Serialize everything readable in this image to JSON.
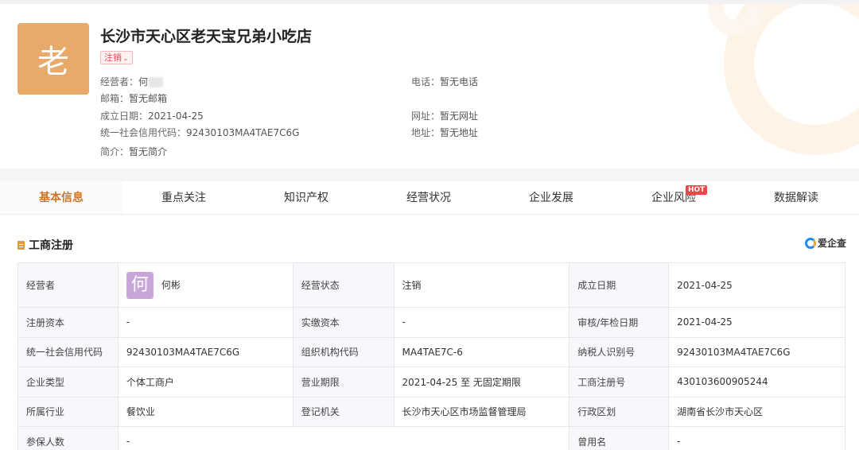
{
  "company": {
    "logo_char": "老",
    "name": "长沙市天心区老天宝兄弟小吃店",
    "status_tag": "注销",
    "operator_label": "经营者：",
    "operator_value": "何",
    "email_label": "邮箱：",
    "email_value": "暂无邮箱",
    "founded_label": "成立日期：",
    "founded_value": "2021-04-25",
    "credit_label": "统一社会信用代码：",
    "credit_value": "92430103MA4TAE7C6G",
    "intro_label": "简介：",
    "intro_value": "暂无简介",
    "phone_label": "电话：",
    "phone_value": "暂无电话",
    "website_label": "网址：",
    "website_value": "暂无网址",
    "address_label": "地址：",
    "address_value": "暂无地址"
  },
  "tabs": [
    {
      "label": "基本信息"
    },
    {
      "label": "重点关注"
    },
    {
      "label": "知识产权"
    },
    {
      "label": "经营状况"
    },
    {
      "label": "企业发展"
    },
    {
      "label": "企业风险",
      "badge": "HOT"
    },
    {
      "label": "数据解读"
    }
  ],
  "section": {
    "title": "工商注册",
    "brand": "爱企查"
  },
  "table": {
    "r1": {
      "k1": "经营者",
      "avatar": "何",
      "v1": "何彬",
      "k2": "经营状态",
      "v2": "注销",
      "k3": "成立日期",
      "v3": "2021-04-25"
    },
    "r2": {
      "k1": "注册资本",
      "v1": "-",
      "k2": "实缴资本",
      "v2": "-",
      "k3": "审核/年检日期",
      "v3": "2021-04-25"
    },
    "r3": {
      "k1": "统一社会信用代码",
      "v1": "92430103MA4TAE7C6G",
      "k2": "组织机构代码",
      "v2": "MA4TAE7C-6",
      "k3": "纳税人识别号",
      "v3": "92430103MA4TAE7C6G"
    },
    "r4": {
      "k1": "企业类型",
      "v1": "个体工商户",
      "k2": "营业期限",
      "v2": "2021-04-25 至 无固定期限",
      "k3": "工商注册号",
      "v3": "430103600905244"
    },
    "r5": {
      "k1": "所属行业",
      "v1": "餐饮业",
      "k2": "登记机关",
      "v2": "长沙市天心区市场监督管理局",
      "k3": "行政区划",
      "v3": "湖南省长沙市天心区"
    },
    "r6": {
      "k1": "参保人数",
      "v1": "-",
      "k3": "曾用名",
      "v3": "-"
    }
  }
}
